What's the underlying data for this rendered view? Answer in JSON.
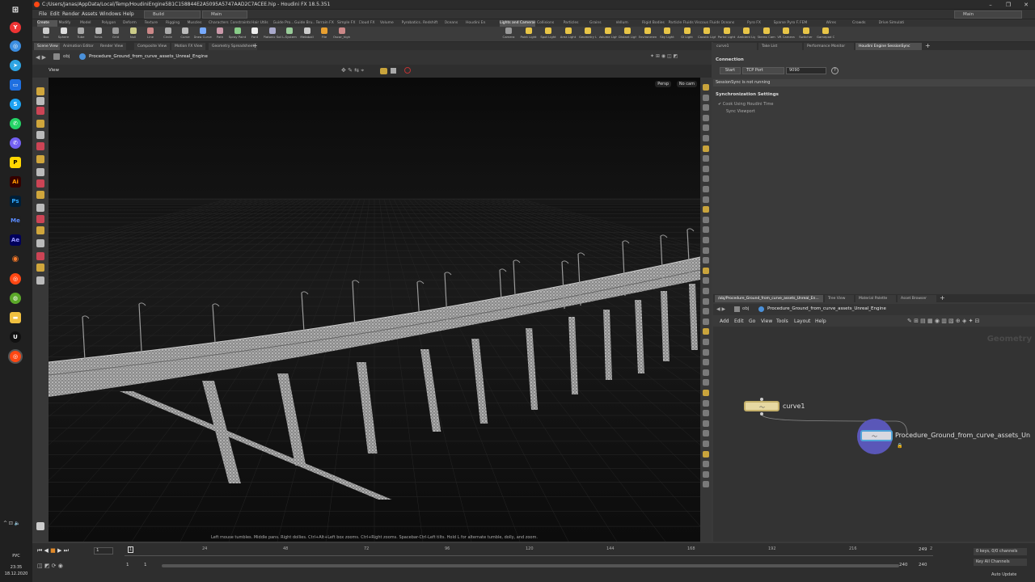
{
  "window": {
    "title": "C:/Users/Janas/AppData/Local/Temp/HoudiniEngine5B1C158844E2A5095A5747AAD2C7ACEE.hip - Houdini FX 18.5.351"
  },
  "menu": [
    "File",
    "Edit",
    "Render",
    "Assets",
    "Windows",
    "Help"
  ],
  "desktop_dropdowns": {
    "build": "Build",
    "main": "Main",
    "right": "Main"
  },
  "shelf_tabs_left": [
    "Create",
    "Modify",
    "Model",
    "Polygon",
    "Deform",
    "Texture",
    "Rigging",
    "Muscles",
    "Characters",
    "Constraints",
    "Hair Utils",
    "Guide Pro...",
    "Guide Bru...",
    "Terrain FX",
    "Simple FX",
    "Cloud FX",
    "Volume",
    "Pyrobatics...",
    "Redshift",
    "Oceans",
    "Houdini En..."
  ],
  "shelf_tabs_right": [
    "Lights and Cameras",
    "Collisions",
    "Particles",
    "Grains",
    "Vellum",
    "Rigid Bodies",
    "Particle Fluids",
    "Viscous Fluids",
    "Oceans",
    "Pyro FX",
    "Sparse Pyro FX",
    "FEM",
    "Wires",
    "Crowds",
    "Drive Simulation"
  ],
  "tools_left": [
    "Box",
    "Sphere",
    "Tube",
    "Torus",
    "Grid",
    "Null",
    "Line",
    "Circle",
    "Curve",
    "Draw Curve",
    "Path",
    "Spray Paint",
    "Font",
    "Platonic Solids",
    "L-System",
    "Metaball",
    "File",
    "Oscar_high"
  ],
  "tools_right": [
    "Camera",
    "Point Light",
    "Spot Light",
    "Area Light",
    "Geometry Light",
    "Volume Light",
    "Distant Light",
    "Environment Light",
    "Sky Light",
    "GI Light",
    "Caustic Light",
    "Portal Light",
    "Ambient Light",
    "Stereo Camera",
    "VR Camera",
    "Switcher",
    "Gamepad Camera"
  ],
  "pane_tabs": [
    "Scene View",
    "Animation Editor",
    "Render View",
    "Composite View",
    "Motion FX View",
    "Geometry Spreadsheet"
  ],
  "path": {
    "root": "obj",
    "node": "Procedure_Ground_from_curve_assets_Unreal_Engine"
  },
  "viewport": {
    "label": "View",
    "persp": "Persp",
    "cam": "No cam",
    "hint": "Left mouse tumbles. Middle pans. Right dollies. Ctrl+Alt+Left box zooms. Ctrl+Right zooms. Spacebar-Ctrl-Left tilts. Hold L for alternate tumble, dolly, and zoom."
  },
  "right_top": {
    "tabs": [
      "curve1",
      "Take List",
      "Performance Monitor",
      "Houdini Engine SessionSync"
    ],
    "connection": "Connection",
    "start": "Start",
    "type": "TCP Port",
    "port": "9090",
    "status": "SessionSync is not running",
    "sync_title": "Synchronization Settings",
    "cook": "Cook Using Houdini Time",
    "sync_vp": "Sync Viewport"
  },
  "right_bot": {
    "tabs": [
      "/obj/Procedure_Ground_from_curve_assets_Unreal_En...",
      "Tree View",
      "Material Palette",
      "Asset Browser"
    ],
    "path_root": "obj",
    "path_node": "Procedure_Ground_from_curve_assets_Unreal_Engine",
    "menu": [
      "Add",
      "Edit",
      "Go",
      "View",
      "Tools",
      "Layout",
      "Help"
    ],
    "context": "Geometry",
    "nodes": [
      "curve1",
      "Procedure_Ground_from_curve_assets_Un"
    ]
  },
  "timeline": {
    "frame": "1",
    "start": "1",
    "start2": "1",
    "end": "240",
    "end2": "240",
    "end_disp": "249",
    "ticks": [
      "24",
      "48",
      "72",
      "96",
      "120",
      "144",
      "168",
      "192",
      "216",
      "2"
    ],
    "keys": "0 keys, 0/0 channels",
    "keyall": "Key All Channels",
    "auto": "Auto Update"
  },
  "clock": {
    "lang": "РУС",
    "time": "23:35",
    "date": "18.12.2020"
  }
}
